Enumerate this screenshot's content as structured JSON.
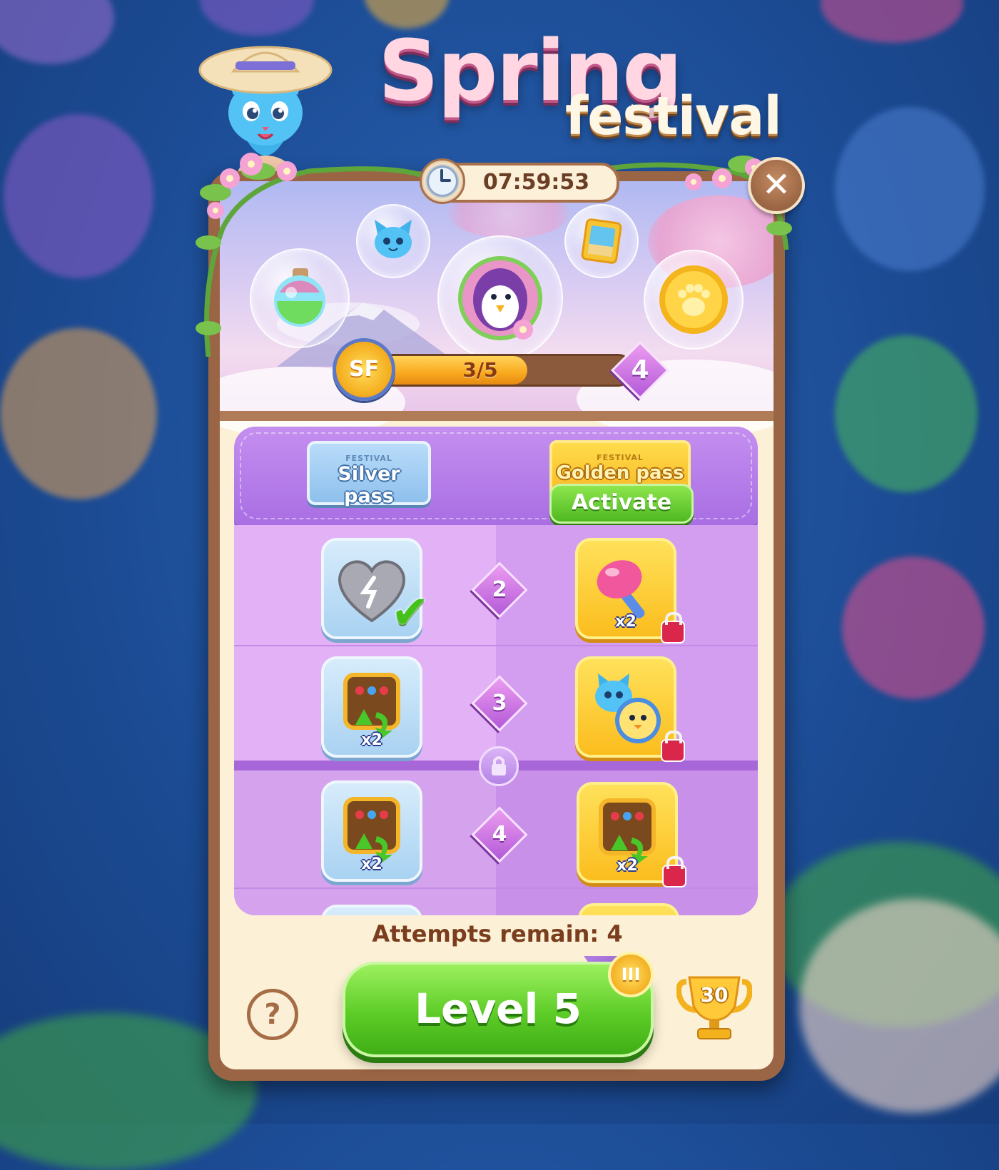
{
  "event": {
    "title_line1": "Spring",
    "title_line2": "festival",
    "timer": "07:59:53"
  },
  "progress": {
    "badge": "SF",
    "text": "3/5",
    "current": 3,
    "total": 5,
    "next_tier": "4"
  },
  "passes": {
    "silver": {
      "small": "FESTIVAL",
      "label": "Silver pass"
    },
    "golden": {
      "small": "FESTIVAL",
      "label": "Golden pass",
      "action": "Activate"
    }
  },
  "tiers": [
    {
      "number": "2",
      "silver_reward": "heart-stone",
      "silver_claimed": true,
      "gold_reward": "lollipop-hammer",
      "gold_multiplier": "x2",
      "gold_locked": true
    },
    {
      "number": "3",
      "silver_reward": "shuffle-booster",
      "silver_multiplier": "x2",
      "gold_reward": "cat-and-chick-characters",
      "gold_locked": true
    },
    {
      "number": "4",
      "silver_reward": "shuffle-booster",
      "silver_multiplier": "x2",
      "gold_reward": "shuffle-booster",
      "gold_multiplier": "x2",
      "gold_locked": true
    }
  ],
  "footer": {
    "attempts": "Attempts remain: 4",
    "help": "?",
    "level_button": "Level 5",
    "tier_badge": "III",
    "trophy_count": "30"
  },
  "colors": {
    "background": "#1c4c95",
    "panel_frame": "#9a6544",
    "play_green": "#5dcc27",
    "pass_purple": "#a96ee3"
  }
}
